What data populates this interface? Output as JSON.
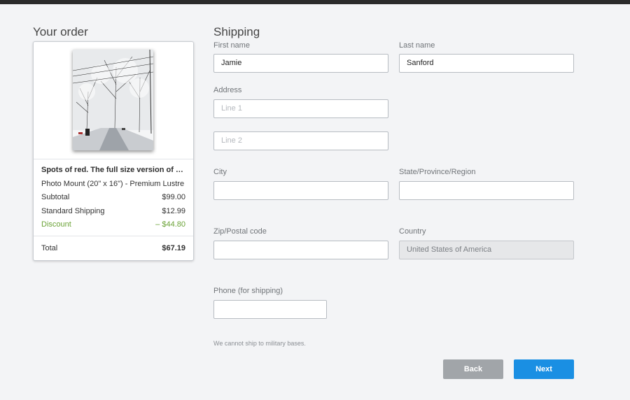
{
  "order": {
    "heading": "Your order",
    "item_title": "Spots of red. The full size version of an ...",
    "item_desc": "Photo Mount (20\" x 16\") - Premium Lustre",
    "subtotal_label": "Subtotal",
    "subtotal_value": "$99.00",
    "shipping_label": "Standard Shipping",
    "shipping_value": "$12.99",
    "discount_label": "Discount",
    "discount_value": "– $44.80",
    "total_label": "Total",
    "total_value": "$67.19",
    "discount_color": "#6aa236"
  },
  "shipping": {
    "heading": "Shipping",
    "first_name": {
      "label": "First name",
      "value": "Jamie"
    },
    "last_name": {
      "label": "Last name",
      "value": "Sanford"
    },
    "address": {
      "label": "Address",
      "line1_placeholder": "Line 1",
      "line2_placeholder": "Line 2"
    },
    "city": {
      "label": "City",
      "value": ""
    },
    "state": {
      "label": "State/Province/Region",
      "value": ""
    },
    "zip": {
      "label": "Zip/Postal code",
      "value": ""
    },
    "country": {
      "label": "Country",
      "value": "United States of America"
    },
    "phone": {
      "label": "Phone (for shipping)",
      "value": ""
    },
    "note": "We cannot ship to military bases."
  },
  "actions": {
    "back_label": "Back",
    "next_label": "Next",
    "next_color": "#1a8fe3",
    "back_color": "#a1a5a9"
  }
}
